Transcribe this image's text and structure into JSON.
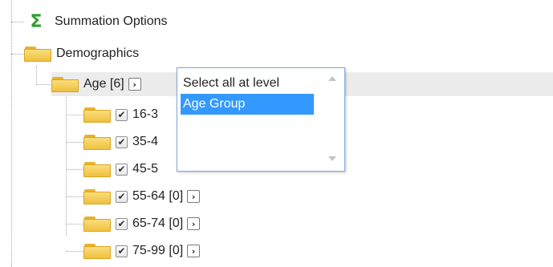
{
  "tree": {
    "summation": {
      "label": "Summation Options",
      "icon": "sigma-icon"
    },
    "demographics": {
      "label": "Demographics",
      "icon": "folder-icon"
    },
    "age": {
      "label": "Age [6]",
      "expand_symbol": "›"
    },
    "age_groups": [
      {
        "label": "16-3",
        "checked": true
      },
      {
        "label": "35-4",
        "checked": true
      },
      {
        "label": "45-5",
        "checked": true
      },
      {
        "label": "55-64 [0]",
        "checked": true
      },
      {
        "label": "65-74 [0]",
        "checked": true
      },
      {
        "label": "75-99 [0]",
        "checked": true
      }
    ],
    "check_symbol": "✔",
    "expand_symbol": "›"
  },
  "level_dropdown": {
    "options": [
      "Select all at level",
      "Age Group"
    ],
    "highlighted": "Age Group"
  },
  "colors": {
    "sigma": "#2e9e2e",
    "folder": "#f0c040",
    "highlight": "#3399ff",
    "listbox_border": "#7fa9dc"
  }
}
